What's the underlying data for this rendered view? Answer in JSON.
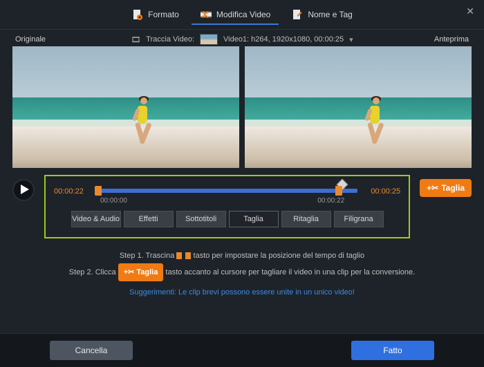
{
  "top_tabs": {
    "format": "Formato",
    "edit": "Modifica Video",
    "nametag": "Nome e Tag"
  },
  "track": {
    "label": "Traccia Video:",
    "info": "Video1: h264, 1920x1080, 00:00:25"
  },
  "preview_labels": {
    "original": "Originale",
    "preview": "Anteprima"
  },
  "timeline": {
    "current": "00:00:22",
    "total": "00:00:25",
    "start": "00:00:00",
    "end": "00:00:22"
  },
  "subtabs": {
    "va": "Video & Audio",
    "eff": "Effetti",
    "sub": "Sottotitoli",
    "trim": "Taglia",
    "crop": "Ritaglia",
    "wm": "Filigrana"
  },
  "cut_button": "Taglia",
  "steps": {
    "s1a": "Step 1. Trascina",
    "s1b": "tasto per impostare la posizione del tempo di taglio",
    "s2a": "Step 2. Clicca",
    "s2_btn": "Taglia",
    "s2b": "tasto accanto al cursore per tagliare il video in una clip per la conversione."
  },
  "tip": "Suggerimenti: Le clip brevi possono essere unite in un unico video!",
  "footer": {
    "cancel": "Cancella",
    "done": "Fatto"
  }
}
